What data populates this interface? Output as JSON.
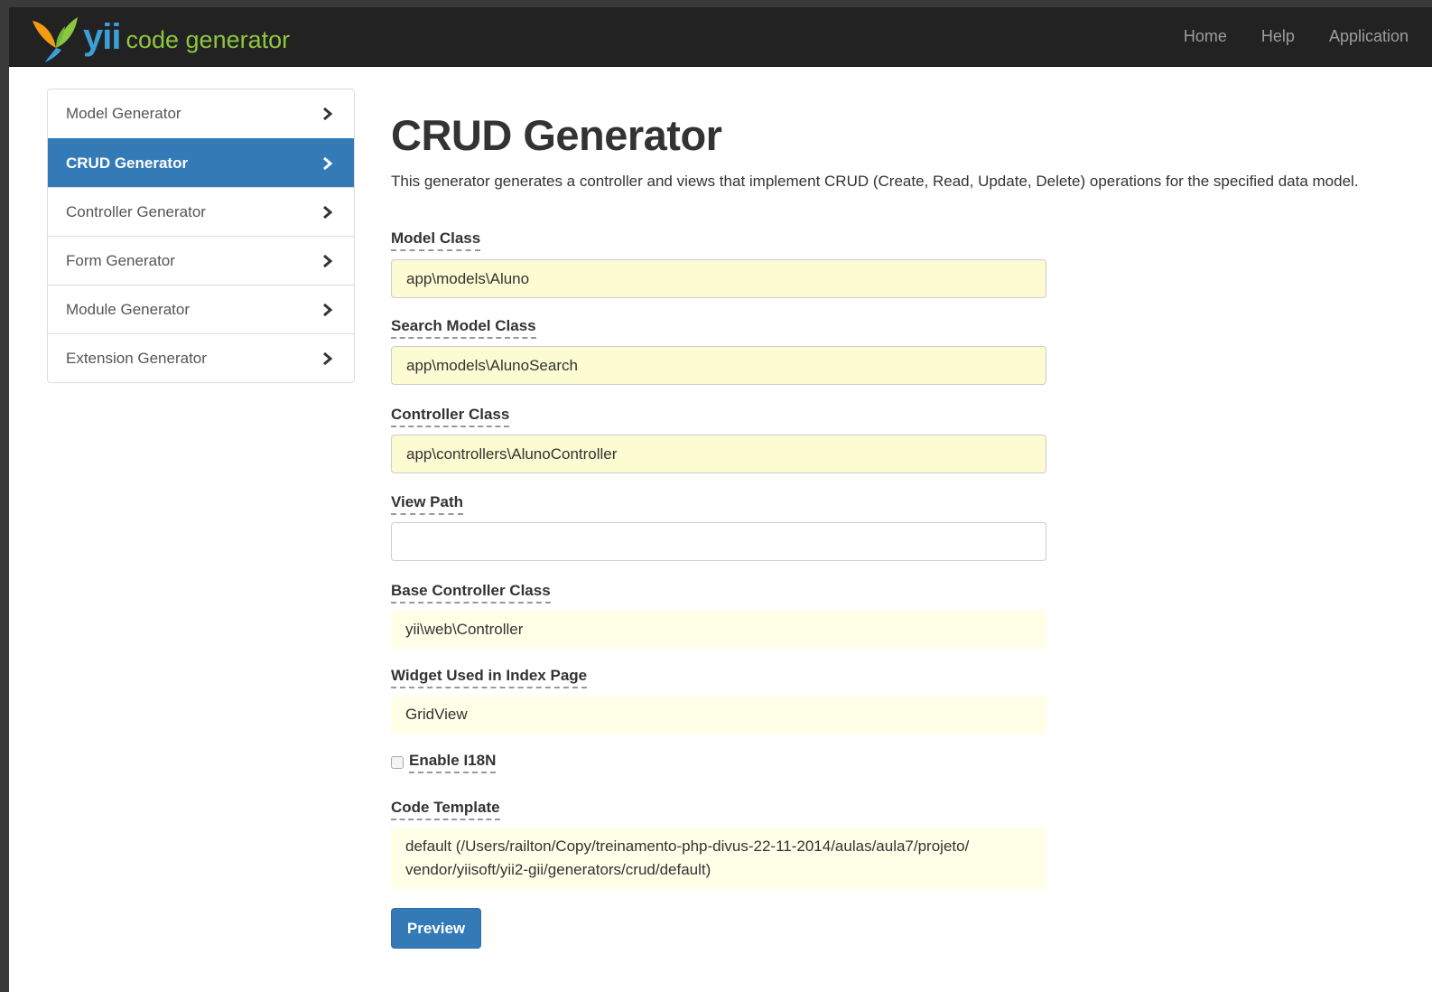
{
  "brand": {
    "logo_text": "yii",
    "subtitle": "code generator"
  },
  "nav": {
    "items": [
      "Home",
      "Help",
      "Application"
    ]
  },
  "sidebar": {
    "items": [
      {
        "label": "Model Generator",
        "active": false
      },
      {
        "label": "CRUD Generator",
        "active": true
      },
      {
        "label": "Controller Generator",
        "active": false
      },
      {
        "label": "Form Generator",
        "active": false
      },
      {
        "label": "Module Generator",
        "active": false
      },
      {
        "label": "Extension Generator",
        "active": false
      }
    ]
  },
  "page": {
    "title": "CRUD Generator",
    "description": "This generator generates a controller and views that implement CRUD (Create, Read, Update, Delete) operations for the specified data model."
  },
  "form": {
    "model_class": {
      "label": "Model Class",
      "value": "app\\models\\Aluno"
    },
    "search_model_class": {
      "label": "Search Model Class",
      "value": "app\\models\\AlunoSearch"
    },
    "controller_class": {
      "label": "Controller Class",
      "value": "app\\controllers\\AlunoController"
    },
    "view_path": {
      "label": "View Path",
      "value": ""
    },
    "base_controller_class": {
      "label": "Base Controller Class",
      "value": "yii\\web\\Controller"
    },
    "index_widget": {
      "label": "Widget Used in Index Page",
      "value": "GridView"
    },
    "enable_i18n": {
      "label": "Enable I18N",
      "checked": false
    },
    "code_template": {
      "label": "Code Template",
      "value_line1": "default (/Users/railton/Copy/treinamento-php-divus-22-11-2014/aulas/aula7/projeto/",
      "value_line2": "vendor/yiisoft/yii2-gii/generators/crud/default)"
    },
    "preview_label": "Preview"
  },
  "colors": {
    "navbar_bg": "#222222",
    "active_blue": "#337ab7",
    "input_highlight": "#fcfbd2",
    "sticky_bg": "#fffee7",
    "brand_blue": "#3b9fd8",
    "brand_green": "#8dc63f"
  }
}
